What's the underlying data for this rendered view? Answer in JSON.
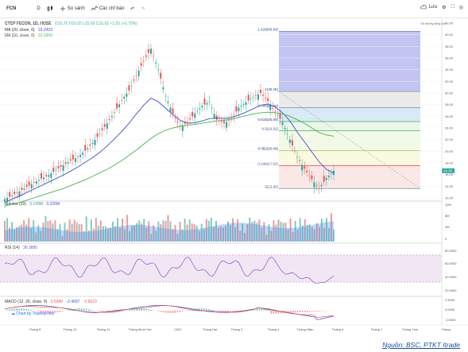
{
  "toolbar": {
    "symbol": "FCN",
    "interval": "D",
    "compare": "So sánh",
    "indicators": "Các chỉ báo",
    "save": "Lưu"
  },
  "legend": {
    "main": "CTCP FECON, 1D, HOSE",
    "ohlc": "O15.70 H16.65 L15.60 C16.65 +1.05 (+6.73%)",
    "ma20_label": "MA (20, close, 0)",
    "ma20_value": "16.2423",
    "ma50_label": "MA (50, close, 0)",
    "ma50_value": "22.5800",
    "volume_label": "Volume (20)",
    "volume_v1": "5.149M",
    "volume_v2": "3.226M",
    "rsi_label": "RSI (14)",
    "rsi_value": "36.3885",
    "macd_label": "MACD (12, 26, close, 9)",
    "macd_v1": "0.5499",
    "macd_v2": "-2.4097",
    "macd_v3": "-2.9623",
    "tv_credit": "Chart by TradingView",
    "watermark": "Thị trường đóng cửa"
  },
  "fib": [
    {
      "label": "1.618(40.54)",
      "price": 40.54,
      "color": "#3f4ec9"
    },
    {
      "label": "1(30.25)",
      "price": 30.25,
      "color": "#888888"
    },
    {
      "label": "0.786(27.48)",
      "price": 27.48,
      "color": "#888888"
    },
    {
      "label": "0.618(25.09)",
      "price": 25.09,
      "color": "#4caf50"
    },
    {
      "label": "0.5(23.52)",
      "price": 23.52,
      "color": "#4caf50"
    },
    {
      "label": "0.382(20.08)",
      "price": 20.08,
      "color": "#8bc34a"
    },
    {
      "label": "0.236(17.52)",
      "price": 17.52,
      "color": "#f44336"
    },
    {
      "label": "0(13.60)",
      "price": 13.6,
      "color": "#888888"
    }
  ],
  "price_axis": [
    "42.00",
    "40.00",
    "38.00",
    "36.00",
    "34.00",
    "32.00",
    "30.00",
    "28.00",
    "26.00",
    "24.00",
    "22.00",
    "20.00",
    "18.00",
    "16.00",
    "14.00",
    "12.00"
  ],
  "last_price": "16.65",
  "volume_axis": [
    "12M",
    "8M",
    "4M",
    "0"
  ],
  "rsi_axis": [
    "80.0000",
    "60.0000",
    "40.0000",
    "20.0000"
  ],
  "macd_axis": [
    "2.5000",
    "0.0000",
    "-2.5000"
  ],
  "time_axis": [
    "Tháng 8",
    "Tháng 10",
    "Tháng 11",
    "Tháng Mười Hai",
    "2022",
    "Tháng Hai",
    "Tháng 3",
    "Tháng 4",
    "Tháng Năm",
    "Tháng 6",
    "Tháng 7",
    "Tháng Tám",
    "Tháng"
  ],
  "chart_data": {
    "type": "line",
    "title": "CTCP FECON, 1D, HOSE",
    "series": [
      {
        "name": "Close",
        "values": [
          11.8,
          12.4,
          13.1,
          13.9,
          14.6,
          15.3,
          15.9,
          16.8,
          17.6,
          18.4,
          19.0,
          20.1,
          21.4,
          23.0,
          24.8,
          26.6,
          28.8,
          30.4,
          33.0,
          35.5,
          37.6,
          34.0,
          29.5,
          26.5,
          24.2,
          25.0,
          26.5,
          27.8,
          28.5,
          25.4,
          24.8,
          25.5,
          27.5,
          28.4,
          29.3,
          30.0,
          28.6,
          26.8,
          25.0,
          22.0,
          19.0,
          17.0,
          15.2,
          13.6,
          15.4,
          16.65
        ]
      },
      {
        "name": "MA 20",
        "values": [
          11.2,
          11.8,
          12.3,
          12.9,
          13.5,
          14.1,
          14.7,
          15.3,
          15.9,
          16.6,
          17.3,
          18.1,
          18.9,
          19.8,
          20.9,
          22.1,
          23.4,
          24.8,
          26.4,
          27.9,
          29.1,
          28.5,
          27.4,
          26.3,
          25.3,
          24.8,
          24.9,
          25.2,
          25.6,
          25.7,
          25.6,
          25.8,
          26.2,
          26.7,
          27.3,
          27.9,
          28.1,
          27.6,
          26.6,
          25.2,
          23.3,
          21.6,
          19.9,
          18.2,
          16.9,
          16.24
        ]
      },
      {
        "name": "MA 50",
        "values": [
          10.6,
          10.9,
          11.2,
          11.6,
          12.0,
          12.4,
          12.8,
          13.2,
          13.6,
          14.1,
          14.6,
          15.1,
          15.7,
          16.3,
          16.9,
          17.6,
          18.4,
          19.3,
          20.2,
          21.2,
          22.2,
          23.0,
          23.6,
          24.0,
          24.3,
          24.5,
          24.6,
          24.8,
          25.0,
          25.2,
          25.3,
          25.5,
          25.8,
          26.1,
          26.4,
          26.6,
          26.7,
          26.6,
          26.4,
          26.0,
          25.4,
          24.8,
          24.0,
          23.2,
          22.8,
          22.58
        ]
      }
    ],
    "ylim": [
      12,
      42
    ],
    "ylabel": "",
    "xlabel": ""
  }
}
